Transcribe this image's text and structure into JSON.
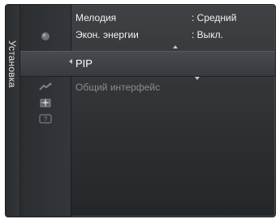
{
  "sidebar": {
    "title": "Установка",
    "icons": [
      {
        "name": "picture-icon"
      },
      {
        "name": "setup-icon"
      },
      {
        "name": "input-icon"
      },
      {
        "name": "application-icon"
      },
      {
        "name": "support-icon"
      }
    ]
  },
  "menu": {
    "items": [
      {
        "label": "Мелодия",
        "value": ": Средний"
      },
      {
        "label": "Экон. энергии",
        "value": ": Выкл."
      },
      {
        "label": "PIP",
        "value": ""
      },
      {
        "label": "Общий интерфейс",
        "value": ""
      }
    ]
  },
  "colors": {
    "panel_bg": "#2e3134",
    "text": "#f2f2f2",
    "disabled_text": "#8a8d90"
  }
}
